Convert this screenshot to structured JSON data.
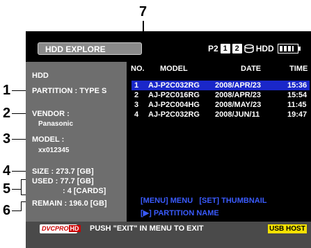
{
  "callouts": [
    "1",
    "2",
    "3",
    "4",
    "5",
    "6",
    "7"
  ],
  "header": {
    "title": "HDD EXPLORE",
    "p2_label": "P2",
    "slot1": "1",
    "slot2": "2",
    "hdd_label": "HDD"
  },
  "left": {
    "hdd": "HDD",
    "partition": "PARTITION : TYPE S",
    "vendor_label": "VENDOR :",
    "vendor_value": "Panasonic",
    "model_label": "MODEL :",
    "model_value": "xx012345",
    "size": "SIZE : 273.7 [GB]",
    "used": "USED : 77.7 [GB]",
    "used_cards": ": 4 [CARDS]",
    "remain": "REMAIN : 196.0 [GB]"
  },
  "table": {
    "columns": [
      "NO.",
      "MODEL",
      "DATE",
      "TIME"
    ],
    "rows": [
      {
        "no": "1",
        "model": "AJ-P2C032RG",
        "date": "2008/APR/23",
        "time": "15:36"
      },
      {
        "no": "2",
        "model": "AJ-P2C016RG",
        "date": "2008/APR/23",
        "time": "15:54"
      },
      {
        "no": "3",
        "model": "AJ-P2C004HG",
        "date": "2008/MAY/23",
        "time": "11:45"
      },
      {
        "no": "4",
        "model": "AJ-P2C032RG",
        "date": "2008/JUN/11",
        "time": "19:47"
      }
    ],
    "selected_index": 0
  },
  "help": {
    "line1": "[MENU] MENU   [SET] THUMBNAIL",
    "line2": "[▶] PARTITION NAME"
  },
  "footer": {
    "dvcpro": "DVCPRO",
    "hd": "HD",
    "message": "PUSH \"EXIT\" IN MENU TO EXIT",
    "usb": "USB HOST"
  },
  "colors": {
    "selection": "#1a27c9",
    "help_text": "#3a5bff",
    "usb_badge": "#f5e100"
  }
}
